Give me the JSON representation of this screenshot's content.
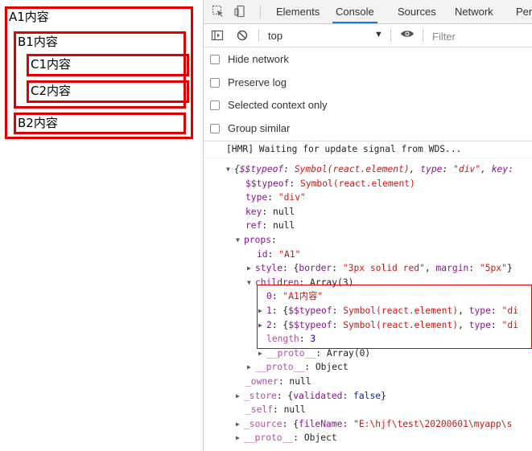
{
  "preview": {
    "a1": "A1内容",
    "b1": "B1内容",
    "c1": "C1内容",
    "c2": "C2内容",
    "b2": "B2内容"
  },
  "devtools": {
    "icons": [
      "inspect-element-icon",
      "device-toolbar-icon"
    ],
    "tabs": [
      "Elements",
      "Console",
      "Sources",
      "Network",
      "Perf"
    ],
    "active_tab": "Console",
    "toolbar": {
      "context": "top",
      "filter_placeholder": "Filter"
    },
    "settings": [
      "Hide network",
      "Preserve log",
      "Selected context only",
      "Group similar"
    ],
    "console": {
      "hmr_message": "[HMR] Waiting for update signal from WDS...",
      "object_summary": {
        "k1": "$$typeof",
        "v1": "Symbol(react.element)",
        "k2": "type",
        "v2": "\"div\"",
        "k3": "key",
        "v3": ""
      },
      "fields": {
        "typeof_key": "$$typeof",
        "typeof_val": "Symbol(react.element)",
        "type_key": "type",
        "type_val": "\"div\"",
        "key_key": "key",
        "key_val": "null",
        "ref_key": "ref",
        "ref_val": "null",
        "props_key": "props",
        "id_key": "id",
        "id_val": "\"A1\"",
        "style_key": "style",
        "style_val_border_key": "border",
        "style_val_border": "\"3px solid red\"",
        "style_val_margin_key": "margin",
        "style_val_margin": "\"5px\"",
        "children_key": "children",
        "children_val": "Array(3)",
        "c0_key": "0",
        "c0_val": "\"A1内容\"",
        "c1_key": "1",
        "c1_tk": "$$typeof",
        "c1_tv": "Symbol(react.element)",
        "c1_type": "type",
        "c1_typeval": "\"di",
        "c2_key": "2",
        "c2_tk": "$$typeof",
        "c2_tv": "Symbol(react.element)",
        "c2_type": "type",
        "c2_typeval": "\"di",
        "length_key": "length",
        "length_val": "3",
        "proto_key": "__proto__",
        "proto_arr": "Array(0)",
        "proto_obj": "Object",
        "owner_key": "_owner",
        "owner_val": "null",
        "store_key": "_store",
        "store_validated": "validated",
        "store_val": "false",
        "self_key": "_self",
        "self_val": "null",
        "source_key": "_source",
        "source_fn_key": "fileName",
        "source_fn_val": "\"E:\\hjf\\test\\20200601\\myapp\\s",
        "proto2_key": "__proto__",
        "proto2_val": "Object"
      }
    }
  }
}
